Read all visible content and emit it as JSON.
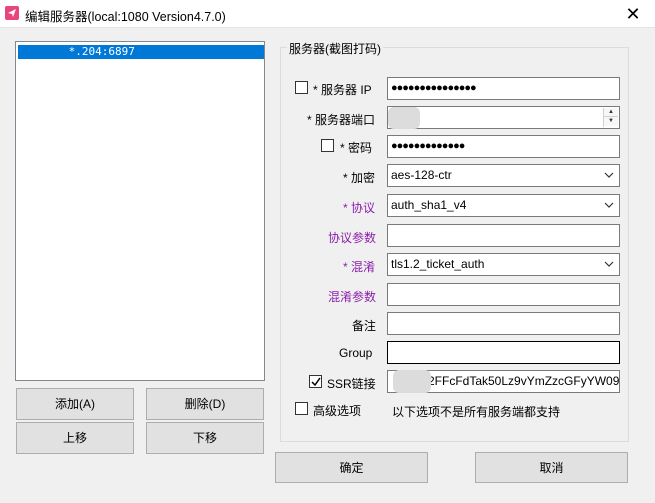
{
  "window": {
    "title": "编辑服务器(local:1080 Version4.7.0)",
    "close_symbol": "✕"
  },
  "server_list": {
    "items": [
      " *.204:6897"
    ]
  },
  "list_buttons": {
    "add": "添加(A)",
    "delete": "删除(D)",
    "move_up": "上移",
    "move_down": "下移"
  },
  "group": {
    "title": "服务器(截图打码)",
    "server_ip_label": "* 服务器 IP",
    "server_ip_value": "●●●●●●●●●●●●●●●",
    "port_label": "* 服务器端口",
    "password_label": "* 密码",
    "password_value": "●●●●●●●●●●●●●",
    "encryption_label": "* 加密",
    "encryption_value": "aes-128-ctr",
    "protocol_label": "* 协议",
    "protocol_value": "auth_sha1_v4",
    "protocol_param_label": "协议参数",
    "protocol_param_value": "",
    "obfs_label": "* 混淆",
    "obfs_value": "tls1.2_ticket_auth",
    "obfs_param_label": "混淆参数",
    "obfs_param_value": "",
    "remark_label": "备注",
    "remark_value": "",
    "group_label": "Group",
    "group_value": "",
    "ssr_link_label": "SSR链接",
    "ssr_link_value": "2FFcFdTak50Lz9vYmZzcGFyYW09",
    "advanced_label": "高级选项",
    "advanced_note": "以下选项不是所有服务端都支持"
  },
  "checkboxes": {
    "server_ip_checked": false,
    "password_checked": false,
    "ssr_link_checked": true,
    "advanced_checked": false
  },
  "dialog_buttons": {
    "ok": "确定",
    "cancel": "取消"
  },
  "colors": {
    "selection": "#0078d7",
    "purple_label": "#8b1fa8",
    "app_icon": "#e8467a"
  },
  "icons": [
    "paper-plane-icon",
    "close-icon",
    "chevron-down-icon",
    "spin-up-icon",
    "spin-down-icon",
    "checkmark-icon"
  ]
}
